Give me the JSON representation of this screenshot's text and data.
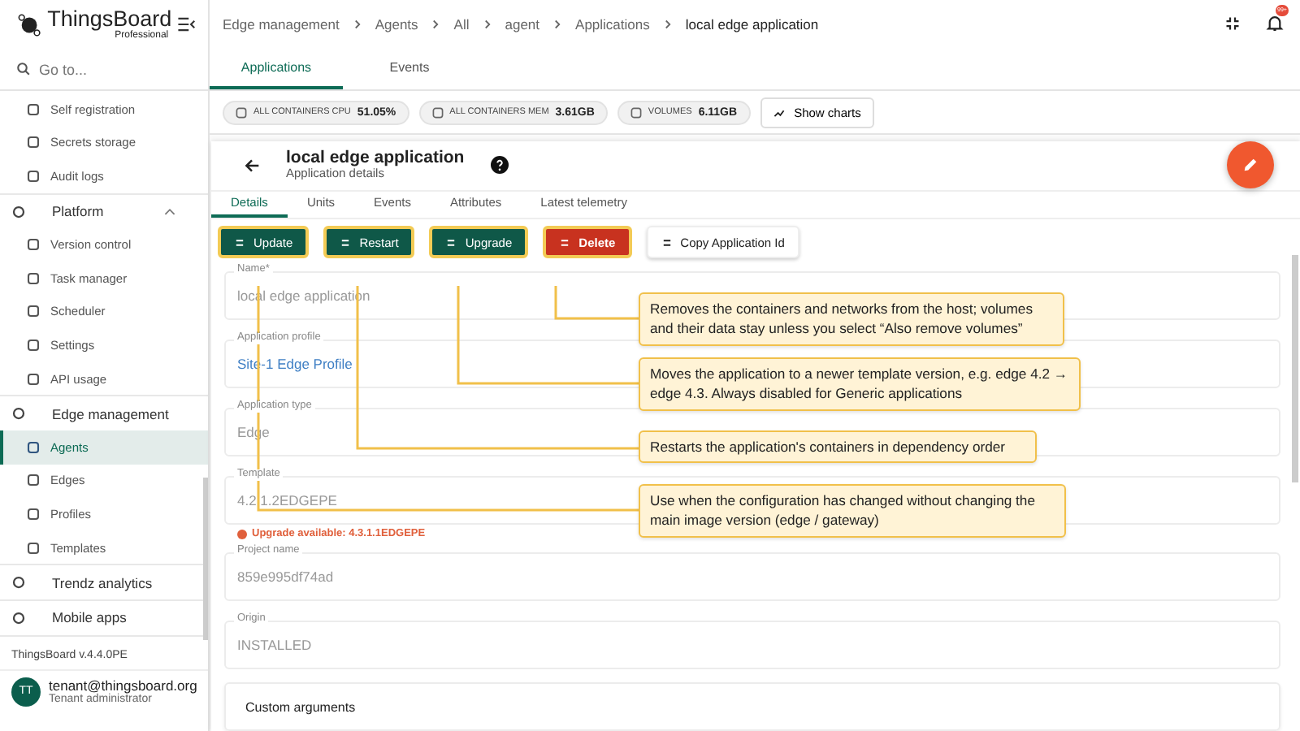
{
  "brand": {
    "name": "ThingsBoard",
    "edition": "Professional"
  },
  "sidebar": {
    "search": {
      "placeholder": "Go to..."
    },
    "items": [
      {
        "children": [
          {
            "label": "Self registration",
            "selected": false
          },
          {
            "label": "Secrets storage",
            "selected": false
          },
          {
            "label": "Audit logs",
            "selected": false
          }
        ]
      },
      {
        "label": "Platform",
        "selected": false,
        "expanded": true,
        "children": [
          {
            "label": "Version control",
            "selected": false
          },
          {
            "label": "Task manager",
            "selected": false
          },
          {
            "label": "Scheduler",
            "selected": false
          },
          {
            "label": "Settings",
            "selected": false
          },
          {
            "label": "API usage",
            "selected": false
          }
        ]
      },
      {
        "label": "Edge management",
        "selected": false,
        "expanded": true,
        "children": [
          {
            "label": "Agents",
            "selected": true
          },
          {
            "label": "Edges",
            "selected": false
          },
          {
            "label": "Profiles",
            "selected": false
          },
          {
            "label": "Templates",
            "selected": false
          }
        ]
      },
      {
        "label": "Trendz analytics",
        "selected": false
      },
      {
        "label": "Mobile apps",
        "selected": false
      }
    ],
    "version": "ThingsBoard v.4.4.0PE",
    "user": {
      "initials": "TT",
      "email": "tenant@thingsboard.org",
      "role": "Tenant administrator"
    }
  },
  "breadcrumbs": [
    "Edge management",
    "Agents",
    "All",
    "agent",
    "Applications",
    "local edge application"
  ],
  "notifications": {
    "badge": "99+"
  },
  "tabs": [
    {
      "label": "Applications",
      "selected": true
    },
    {
      "label": "Events",
      "selected": false
    }
  ],
  "stats": [
    {
      "label": "ALL CONTAINERS CPU",
      "value": "51.05%"
    },
    {
      "label": "ALL CONTAINERS MEM",
      "value": "3.61GB"
    },
    {
      "label": "VOLUMES",
      "value": "6.11GB"
    }
  ],
  "show_charts": "Show charts",
  "details": {
    "title": "local edge application",
    "subtitle": "Application details",
    "tabs": [
      {
        "label": "Details",
        "selected": true
      },
      {
        "label": "Units",
        "selected": false
      },
      {
        "label": "Events",
        "selected": false
      },
      {
        "label": "Attributes",
        "selected": false
      },
      {
        "label": "Latest telemetry",
        "selected": false
      }
    ],
    "actions": [
      {
        "label": "Update",
        "kind": "primary"
      },
      {
        "label": "Restart",
        "kind": "primary"
      },
      {
        "label": "Upgrade",
        "kind": "primary"
      },
      {
        "label": "Delete",
        "kind": "warn"
      },
      {
        "label": "Copy Application Id",
        "kind": "stroked"
      }
    ],
    "fields": [
      {
        "label": "Name*",
        "value": "local edge application",
        "kind": "text",
        "disabled": true
      },
      {
        "label": "Application profile",
        "value": "Site-1 Edge Profile",
        "kind": "link",
        "disabled": true
      },
      {
        "label": "Application type",
        "value": "Edge",
        "kind": "text",
        "disabled": true
      },
      {
        "label": "Template",
        "value": "4.2.1.2EDGEPE",
        "kind": "text",
        "disabled": true,
        "warning": "Upgrade available: 4.3.1.1EDGEPE"
      },
      {
        "label": "Project name",
        "value": "859e995df74ad",
        "kind": "text",
        "disabled": true
      },
      {
        "label": "Origin",
        "value": "INSTALLED",
        "kind": "text",
        "disabled": true
      }
    ],
    "section": "Custom arguments"
  },
  "callouts": [
    {
      "text": "Removes the containers and networks from the host; volumes and their data stay unless you select “Also remove volumes”"
    },
    {
      "text": "Moves the application to a newer template version, e.g. edge 4.2 → edge 4.3. Always disabled for Generic applications"
    },
    {
      "text": "Restarts the application's containers in dependency order"
    },
    {
      "text": "Use when the configuration has changed without changing the main image version (edge / gateway)"
    }
  ]
}
